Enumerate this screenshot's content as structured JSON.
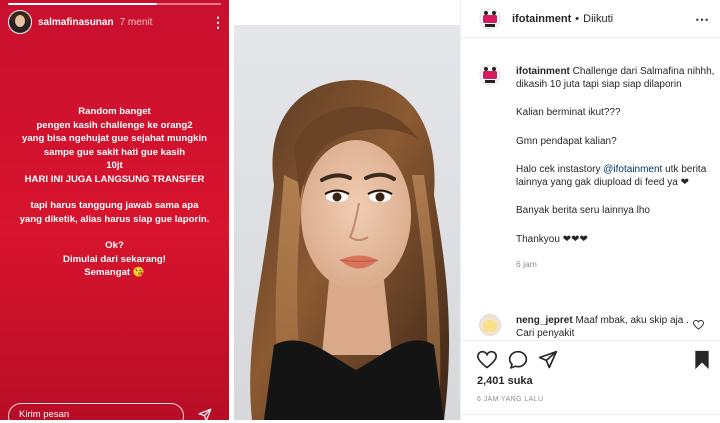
{
  "story": {
    "username": "salmafinasunan",
    "time": "7 menit",
    "progress": 0.7,
    "lines": [
      "Random banget",
      "pengen kasih challenge ke orang2",
      "yang bisa ngehujat gue sejahat mungkin",
      "sampe gue sakit hati gue kasih",
      "10jt",
      "HARI INI JUGA LANGSUNG TRANSFER",
      "",
      "tapi harus tanggung jawab sama apa",
      "yang diketik, alias harus siap gue laporin.",
      "",
      "Ok?",
      "Dimulai dari sekarang!",
      "Semangat 😘"
    ],
    "reply_placeholder": "Kirim pesan",
    "colors": {
      "background": "#d8142e"
    },
    "icons": {
      "more": "more-vertical-icon",
      "send": "send-icon"
    }
  },
  "post": {
    "header": {
      "username": "ifotainment",
      "separator": "•",
      "follow_status": "Diikuti"
    },
    "caption": {
      "username": "ifotainment",
      "first_text": "Challenge dari Salmafina nihhh, dikasih 10 juta tapi siap siap dilaporin",
      "paragraph_2": "Kalian berminat ikut???",
      "paragraph_3": "Gmn pendapat kalian?",
      "paragraph_4_before": "Halo cek instastory ",
      "paragraph_4_mention": "@ifotainment",
      "paragraph_4_after": " utk berita lainnya yang gak diupload di feed ya ❤",
      "paragraph_5": "Banyak berita seru lainnya lho",
      "paragraph_6": "Thankyou ❤❤❤",
      "time": "6 jam"
    },
    "comment": {
      "username": "neng_jepret",
      "text": "Maaf mbak, aku skip aja . Cari penyakit"
    },
    "likes": "2,401 suka",
    "time_ago": "6 JAM YANG LALU",
    "colors": {
      "text": "#262626",
      "muted": "#8e8e8e",
      "mention": "#00376b"
    },
    "icons": [
      "heart-icon",
      "comment-icon",
      "share-icon",
      "bookmark-icon"
    ]
  }
}
